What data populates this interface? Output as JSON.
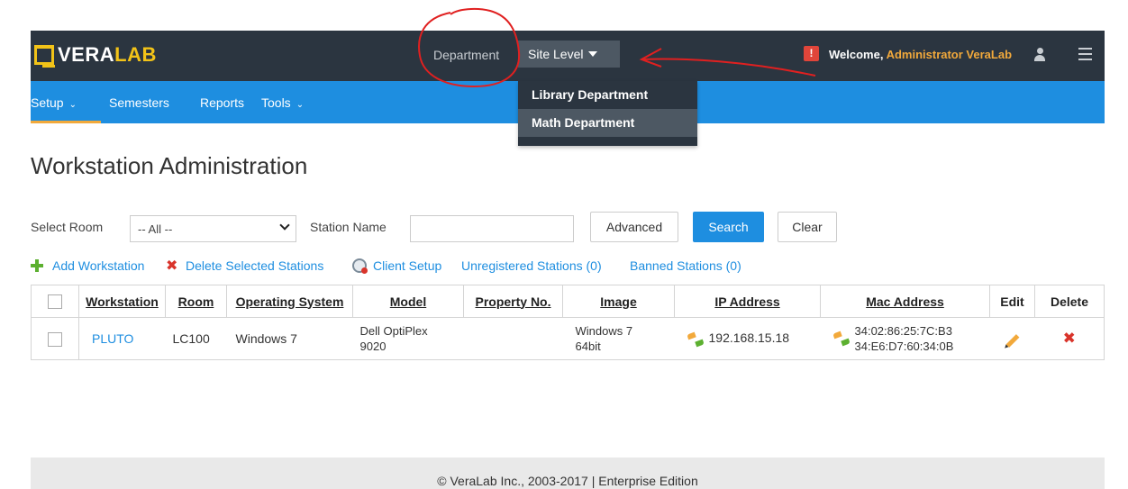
{
  "brand": {
    "name_part1": "VERA",
    "name_part2": "LAB",
    "logo_color": "#f2c318"
  },
  "header": {
    "department_label": "Department",
    "site_level": "Site Level",
    "alert_badge": "!",
    "welcome_prefix": "Welcome, ",
    "welcome_user": "Administrator VeraLab"
  },
  "department_dropdown": {
    "items": [
      {
        "label": "Library Department"
      },
      {
        "label": "Math Department"
      }
    ]
  },
  "nav": {
    "items": [
      {
        "label": "Setup",
        "has_chevron": true
      },
      {
        "label": "Semesters"
      },
      {
        "label": "Reports"
      },
      {
        "label": "Tools",
        "has_chevron": true
      }
    ],
    "chevron": "⌄"
  },
  "page": {
    "title": "Workstation Administration"
  },
  "filters": {
    "room_label": "Select Room",
    "room_value": "-- All --",
    "station_label": "Station Name",
    "station_value": "",
    "advanced_label": "Advanced",
    "search_label": "Search",
    "clear_label": "Clear"
  },
  "actions": {
    "add": "Add Workstation",
    "delete": "Delete Selected Stations",
    "client_setup": "Client Setup",
    "unregistered": "Unregistered Stations (0)",
    "banned": "Banned Stations (0)"
  },
  "table": {
    "columns": [
      "Workstation",
      "Room",
      "Operating System",
      "Model",
      "Property No.",
      "Image",
      "IP Address",
      "Mac Address",
      "Edit",
      "Delete"
    ],
    "rows": [
      {
        "workstation": "PLUTO",
        "room": "LC100",
        "os": "Windows 7",
        "model_line1": "Dell OptiPlex",
        "model_line2": "9020",
        "property_no": "",
        "image_line1": "Windows 7",
        "image_line2": "64bit",
        "ip": "192.168.15.18",
        "mac1": "34:02:86:25:7C:B3",
        "mac2": "34:E6:D7:60:34:0B"
      }
    ]
  },
  "footer": {
    "text": "© VeraLab Inc., 2003-2017 | Enterprise Edition"
  },
  "colors": {
    "navbar": "#2b3540",
    "nav_blue": "#1e8ee0",
    "accent_orange": "#f2a93b",
    "danger": "#d9342b",
    "success": "#5cb030",
    "annotation": "#e02020"
  }
}
